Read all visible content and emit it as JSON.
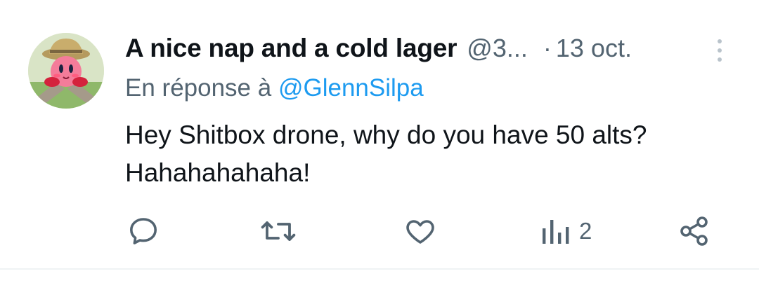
{
  "tweet": {
    "author_name": "A nice nap and a cold lager",
    "author_handle": "@3...",
    "separator": "·",
    "date": "13 oct.",
    "reply_prefix": "En réponse à",
    "reply_mention": "@GlennSilpa",
    "text_line1": "Hey Shitbox drone, why do you have 50 alts?",
    "text_line2": "Hahahahahaha!"
  },
  "actions": {
    "reply_icon": "comment-bubble-icon",
    "retweet_icon": "retweet-icon",
    "like_icon": "heart-icon",
    "views_icon": "bar-chart-icon",
    "views_count": "2",
    "share_icon": "share-icon"
  },
  "colors": {
    "text": "#0f1419",
    "secondary": "#536471",
    "mention": "#1d9bf0",
    "divider": "#eff3f4"
  }
}
